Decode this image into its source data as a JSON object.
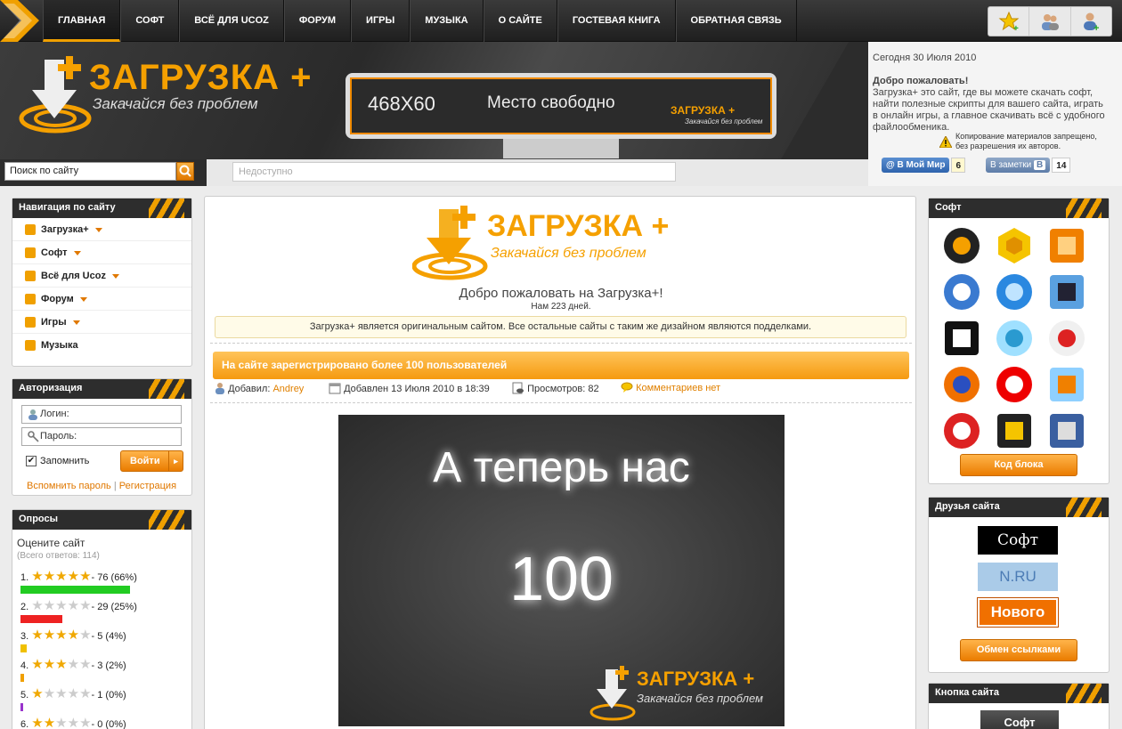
{
  "nav": {
    "items": [
      {
        "label": "ГЛАВНАЯ",
        "active": true
      },
      {
        "label": "СОФТ"
      },
      {
        "label": "ВСЁ ДЛЯ UCOZ"
      },
      {
        "label": "ФОРУМ"
      },
      {
        "label": "ИГРЫ"
      },
      {
        "label": "МУЗЫКА"
      },
      {
        "label": "О САЙТЕ"
      },
      {
        "label": "ГОСТЕВАЯ КНИГА"
      },
      {
        "label": "ОБРАТНАЯ СВЯЗЬ"
      }
    ]
  },
  "header": {
    "logo_title": "ЗАГРУЗКА +",
    "logo_subtitle": "Закачайся без проблем",
    "banner_size": "468X60",
    "banner_text": "Место свободно",
    "banner_logo": "ЗАГРУЗКА +",
    "banner_logo_sub": "Закачайся без проблем"
  },
  "info": {
    "date": "Сегодня 30 Июля 2010",
    "welcome": "Добро пожаловать!",
    "description": "Загрузка+ это сайт, где вы можете скачать софт, найти полезные скрипты для вашего сайта, играть в онлайн игры, а главное скачивать всё с удобного файлообменика.",
    "copyright": "Копирование материалов запрещено, без разрешения их авторов.",
    "moimir_label": "В Мой Мир",
    "moimir_count": "6",
    "vk_label": "В заметки",
    "vk_count": "14"
  },
  "search": {
    "placeholder": "Поиск по сайту",
    "unavailable": "Недоступно"
  },
  "sidebar_nav": {
    "title": "Навигация по сайту",
    "items": [
      "Загрузка+",
      "Софт",
      "Всё для Ucoz",
      "Форум",
      "Игры",
      "Музыка"
    ]
  },
  "auth": {
    "title": "Авторизация",
    "login_placeholder": "Логин:",
    "password_placeholder": "Пароль:",
    "remember": "Запомнить",
    "submit": "Войти",
    "forgot": "Вспомнить пароль",
    "register": "Регистрация"
  },
  "polls": {
    "title": "Опросы",
    "question": "Оцените сайт",
    "total": "(Всего ответов: 114)",
    "answers": [
      {
        "num": "1.",
        "stars": 5,
        "text": "- 76 (66%)",
        "pct": 66,
        "color": "#22cc22"
      },
      {
        "num": "2.",
        "stars": 0,
        "text": "- 29 (25%)",
        "pct": 25,
        "color": "#ee2222"
      },
      {
        "num": "3.",
        "stars": 4,
        "text": "- 5 (4%)",
        "pct": 4,
        "color": "#f0c000"
      },
      {
        "num": "4.",
        "stars": 3,
        "text": "- 3 (2%)",
        "pct": 2,
        "color": "#f0a000"
      },
      {
        "num": "5.",
        "stars": 1,
        "text": "- 1 (0%)",
        "pct": 1,
        "color": "#9933cc"
      },
      {
        "num": "6.",
        "stars": 2,
        "text": "- 0 (0%)",
        "pct": 0,
        "color": "#cccccc"
      }
    ]
  },
  "main": {
    "logo_title": "ЗАГРУЗКА +",
    "logo_subtitle": "Закачайся без проблем",
    "welcome": "Добро пожаловать на Загрузка+!",
    "days": "Нам 223 дней.",
    "notice": "Загрузка+ является оригинальным сайтом. Все остальные сайты с таким же дизайном являются подделками.",
    "news_title": "На сайте зарегистрировано более 100 пользователей",
    "added_by_label": "Добавил:",
    "author": "Andrey",
    "added_date": "Добавлен 13 Июля 2010 в 18:39",
    "views": "Просмотров: 82",
    "comments": "Комментариев нет",
    "image_line1": "А теперь нас",
    "image_line2": "100",
    "image_logo": "ЗАГРУЗКА +",
    "image_logo_sub": "Закачайся без проблем"
  },
  "soft": {
    "title": "Софт",
    "icons": [
      "aimp-icon",
      "bee-icon",
      "download-master-icon",
      "flashget-icon",
      "globe-icon",
      "pen-icon",
      "7zip-icon",
      "qip-icon",
      "pie-chart-icon",
      "firefox-icon",
      "opera-icon",
      "media-player-icon",
      "antivirus-icon",
      "codec-pack-icon",
      "screenshot-icon"
    ],
    "button": "Код блока"
  },
  "friends": {
    "title": "Друзья сайта",
    "items": [
      "Софт",
      "N.RU",
      "Нового"
    ],
    "button": "Обмен ссылками"
  },
  "site_button": {
    "title": "Кнопка сайта",
    "label": "Софт"
  }
}
